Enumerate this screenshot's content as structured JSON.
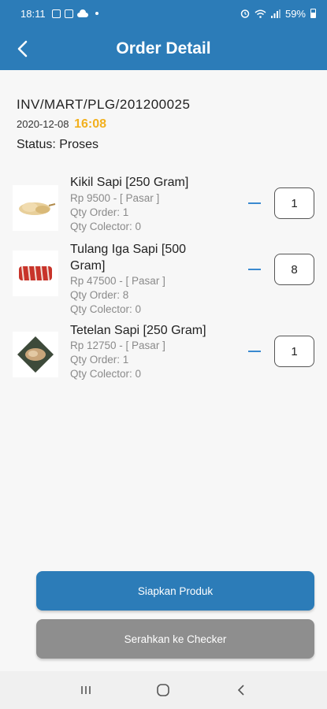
{
  "status_bar": {
    "time": "18:11",
    "battery": "59%"
  },
  "app_bar": {
    "title": "Order Detail",
    "back_icon": "chevron-left-icon"
  },
  "order": {
    "invoice": "INV/MART/PLG/201200025",
    "date": "2020-12-08",
    "time": "16:08",
    "status": "Status: Proses"
  },
  "items": [
    {
      "name": "Kikil Sapi [250 Gram]",
      "price": "Rp 9500 - [ Pasar ]",
      "qty_order": "Qty Order: 1",
      "qty_collector": "Qty Colector: 0",
      "qty": "1"
    },
    {
      "name": "Tulang Iga Sapi [500 Gram]",
      "price": "Rp 47500 - [ Pasar ]",
      "qty_order": "Qty Order: 8",
      "qty_collector": "Qty Colector: 0",
      "qty": "8"
    },
    {
      "name": "Tetelan Sapi [250 Gram]",
      "price": "Rp 12750 - [ Pasar ]",
      "qty_order": "Qty Order: 1",
      "qty_collector": "Qty Colector: 0",
      "qty": "1"
    }
  ],
  "buttons": {
    "prepare": "Siapkan Produk",
    "handover": "Serahkan ke Checker"
  },
  "colors": {
    "primary": "#2c7cb8",
    "accent_time": "#f2b01e",
    "secondary_button": "#8e8e8e"
  }
}
